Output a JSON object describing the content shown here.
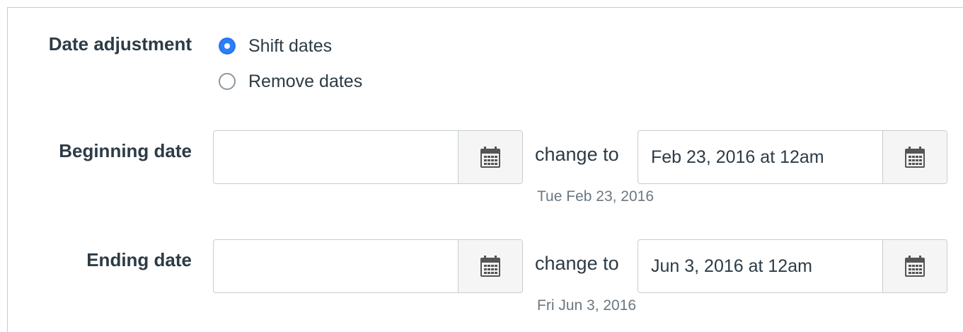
{
  "date_adjustment": {
    "label": "Date adjustment",
    "options": [
      {
        "label": "Shift dates",
        "checked": true
      },
      {
        "label": "Remove dates",
        "checked": false
      }
    ]
  },
  "beginning": {
    "label": "Beginning date",
    "original_value": "",
    "change_to_label": "change to",
    "new_value": "Feb 23, 2016 at 12am",
    "hint": "Tue Feb 23, 2016"
  },
  "ending": {
    "label": "Ending date",
    "original_value": "",
    "change_to_label": "change to",
    "new_value": "Jun 3, 2016 at 12am",
    "hint": "Fri Jun 3, 2016"
  },
  "icons": {
    "calendar": "calendar-icon"
  },
  "colors": {
    "accent": "#2d7ef7",
    "text": "#2d3b45",
    "muted": "#6b7780",
    "border": "#c7cdd1"
  }
}
